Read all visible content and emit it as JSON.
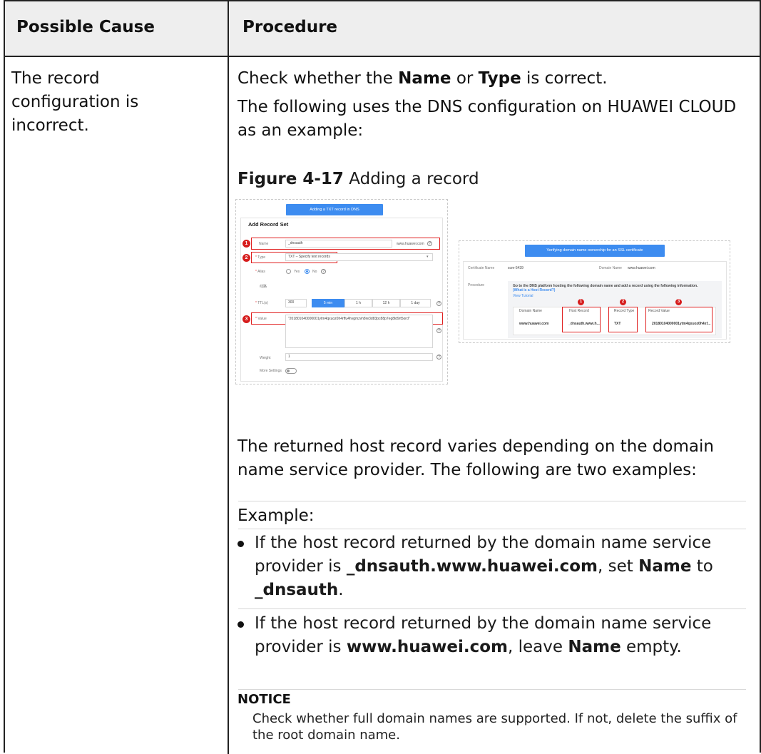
{
  "table": {
    "header": {
      "cause": "Possible Cause",
      "procedure": "Procedure"
    },
    "cause": "The record configuration is incorrect.",
    "procedure": {
      "p1_pre": "Check whether the ",
      "p1_name": "Name",
      "p1_mid": " or ",
      "p1_type": "Type",
      "p1_post": " is correct.",
      "p2": "The following uses the DNS configuration on HUAWEI CLOUD as an example:",
      "figure_number": "Figure 4-17",
      "figure_caption": " Adding a record",
      "p3": "The returned host record varies depending on the domain name service provider. The following are two examples:",
      "p4": "Example:",
      "bullet1_pre": "If the host record returned by the domain name service provider is ",
      "bullet1_host": "_dnsauth.www.huawei.com",
      "bullet1_mid": ", set ",
      "bullet1_name": "Name",
      "bullet1_to": " to ",
      "bullet1_value": "_dnsauth",
      "bullet1_end": ".",
      "bullet2_pre": "If the host record returned by the domain name service provider is ",
      "bullet2_host": "www.huawei.com",
      "bullet2_mid": ", leave ",
      "bullet2_name": "Name",
      "bullet2_end": " empty.",
      "notice_title": "NOTICE",
      "notice_text": "Check whether full domain names are supported. If not, delete the suffix of the root domain name."
    }
  },
  "figure1": {
    "top_button": "Adding a TXT record in DNS",
    "panel_title": "Add Record Set",
    "name_label": "Name",
    "name_value": "_dnsauth",
    "name_suffix": "www.huawei.com",
    "type_label": "Type",
    "type_value": "TXT – Specify text records",
    "alias_label": "Alias",
    "alias_yes": "Yes",
    "alias_no": "No",
    "line_label": "线路",
    "ttl_label": "TTL(s)",
    "ttl_value": "300",
    "ttl_options": [
      "5 min",
      "1 h",
      "12 h",
      "1 day"
    ],
    "value_label": "Value",
    "value_text": "\"201801040000001ytm4qxuoz0h4rffu4hvgmzvh8re3d83pc88p7eg8ld9rt5ord\"",
    "weight_label": "Weight",
    "weight_value": "1",
    "more_label": "More Settings",
    "badges": [
      "1",
      "2",
      "3"
    ]
  },
  "figure2": {
    "top_button": "Verifying domain name ownership for an SSL certificate",
    "cert_label": "Certificate Name",
    "cert_value": "scm-5439",
    "domain_label": "Domain Name",
    "domain_value": "www.huawei.com",
    "procedure_label": "Procedure",
    "instruction": "Go to the DNS platform hosting the following domain name and add a record using the following information.",
    "instruction_link": "(What is a Host Record?)",
    "tutorial_link": "View Tutorial",
    "columns": [
      "Domain Name",
      "Host Record",
      "Record Type",
      "Record Value"
    ],
    "row": [
      "www.huawei.com",
      "_dnsauth.www.h...",
      "TXT",
      "20180104000001ytm4qxuoz0h4xf..."
    ],
    "badges": [
      "1",
      "2",
      "3"
    ]
  },
  "colors": {
    "accent": "#3d8cf0",
    "highlight": "#e02020",
    "header_bg": "#eeeeee"
  }
}
